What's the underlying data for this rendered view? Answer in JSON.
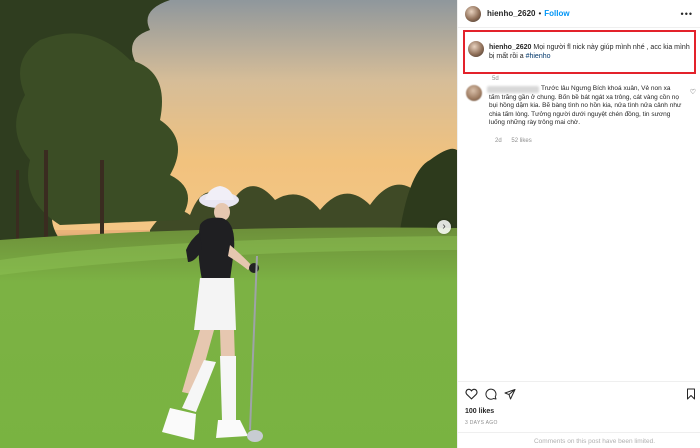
{
  "post": {
    "username": "hienho_2620",
    "follow_label": "Follow",
    "more_label": "•••",
    "next_arrow": "›"
  },
  "caption": {
    "username": "hienho_2620",
    "text": "Mọi người fl nick này giúp mình nhé , acc kia mình bị mất rồi a",
    "hashtag": "#hienho",
    "time": "5d",
    "highlight_color": "#e3222b"
  },
  "comment": {
    "text": "Trước lâu Ngưng Bích khoá xuân, Vẻ non xa tấm trăng gần ở chung. Bốn bề bát ngát xa trông, cát vàng cồn nọ bụi hồng dặm kia. Bẽ bàng tình no hồn kia, nửa tình nửa cảnh như chia tấm lòng. Tưởng người dưới nguyệt chén đồng, tin sương luống những rày trông mai chờ.",
    "time": "2d",
    "likes": "52 likes"
  },
  "actions": {
    "like_icon": "heart-icon",
    "comment_icon": "comment-icon",
    "share_icon": "share-icon",
    "save_icon": "bookmark-icon"
  },
  "likes_count": "100 likes",
  "date": "3 DAYS AGO",
  "comments_limited": "Comments on this post have been limited.",
  "colors": {
    "link": "#0095f6",
    "hashtag": "#00376b",
    "meta": "#8e8e8e"
  }
}
